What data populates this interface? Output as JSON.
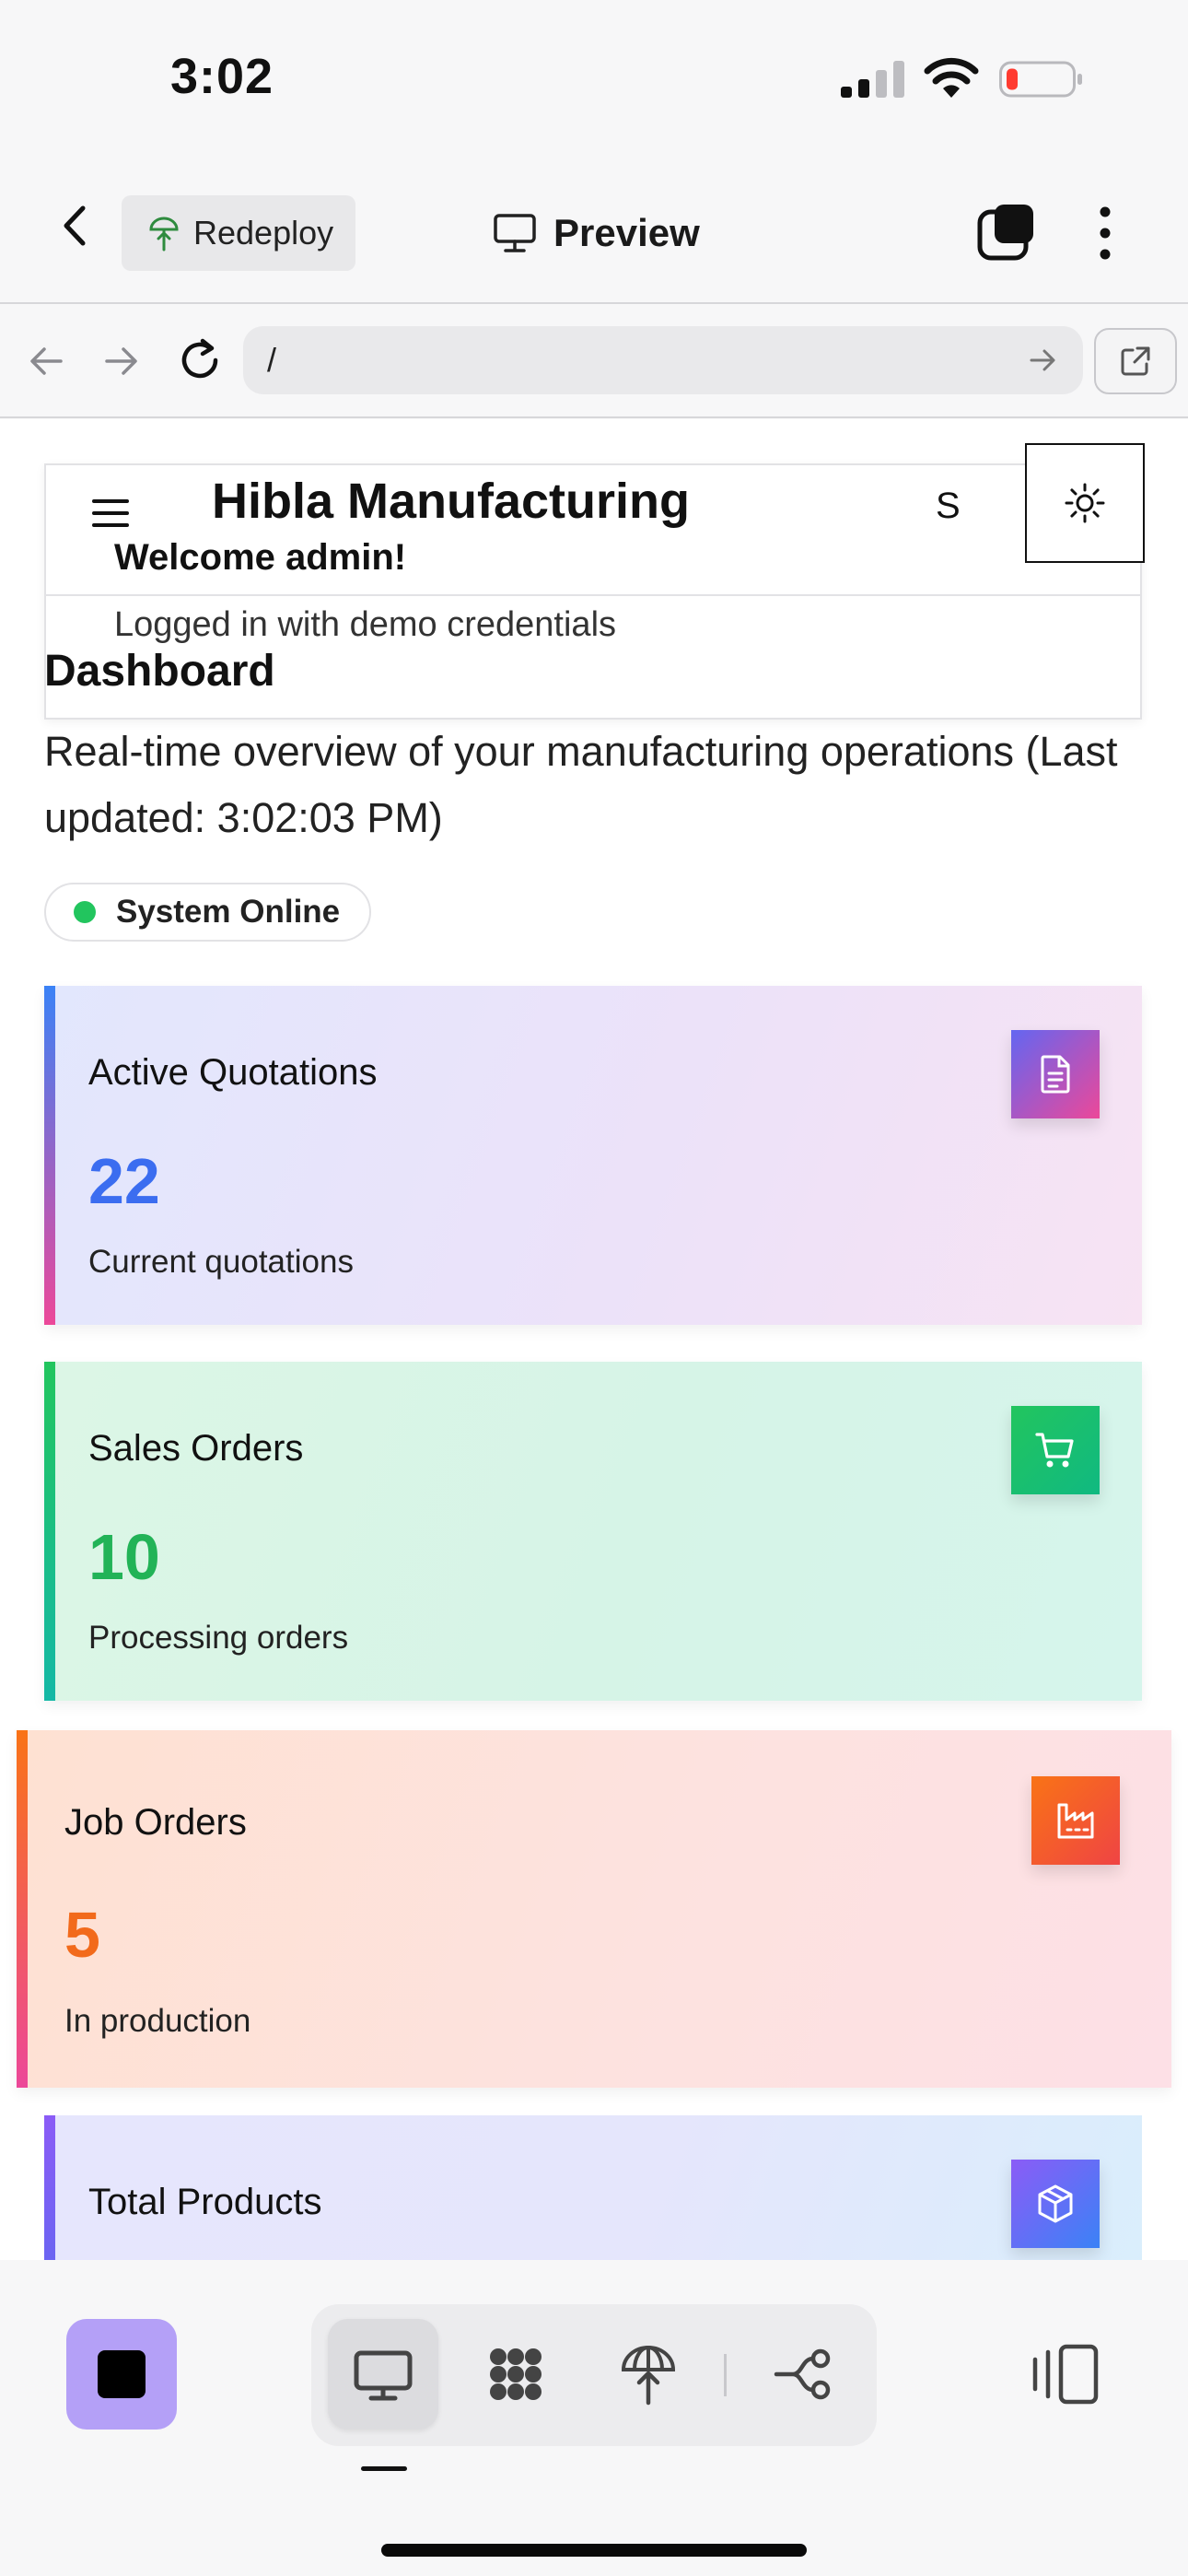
{
  "status_bar": {
    "time": "3:02",
    "battery_color": "#ff3b30"
  },
  "toolbar": {
    "redeploy_label": "Redeploy",
    "title": "Preview"
  },
  "browser": {
    "url": "/"
  },
  "header": {
    "brand": "Hibla Manufacturing",
    "user_initial": "S",
    "welcome": "Welcome admin!",
    "logged_in": "Logged in with demo credentials"
  },
  "dashboard": {
    "title": "Dashboard",
    "subtitle": "Real-time overview of your manufacturing operations (Last updated: 3:02:03 PM)",
    "system_status": "System Online",
    "status_color": "#22c55e"
  },
  "cards": [
    {
      "title": "Active Quotations",
      "value": "22",
      "desc": "Current quotations",
      "icon": "document-icon",
      "accent": "#3b6df0"
    },
    {
      "title": "Sales Orders",
      "value": "10",
      "desc": "Processing orders",
      "icon": "cart-icon",
      "accent": "#22b357"
    },
    {
      "title": "Job Orders",
      "value": "5",
      "desc": "In production",
      "icon": "factory-icon",
      "accent": "#f26a1b"
    },
    {
      "title": "Total Products",
      "icon": "box-icon",
      "accent": "#8b5cf6"
    }
  ],
  "bottom_bar": {
    "stop_color": "#b4a0f7",
    "tabs": [
      "desktop-icon",
      "apps-grid-icon",
      "deploy-icon",
      "workflow-icon"
    ],
    "panel": "panel-icon"
  }
}
